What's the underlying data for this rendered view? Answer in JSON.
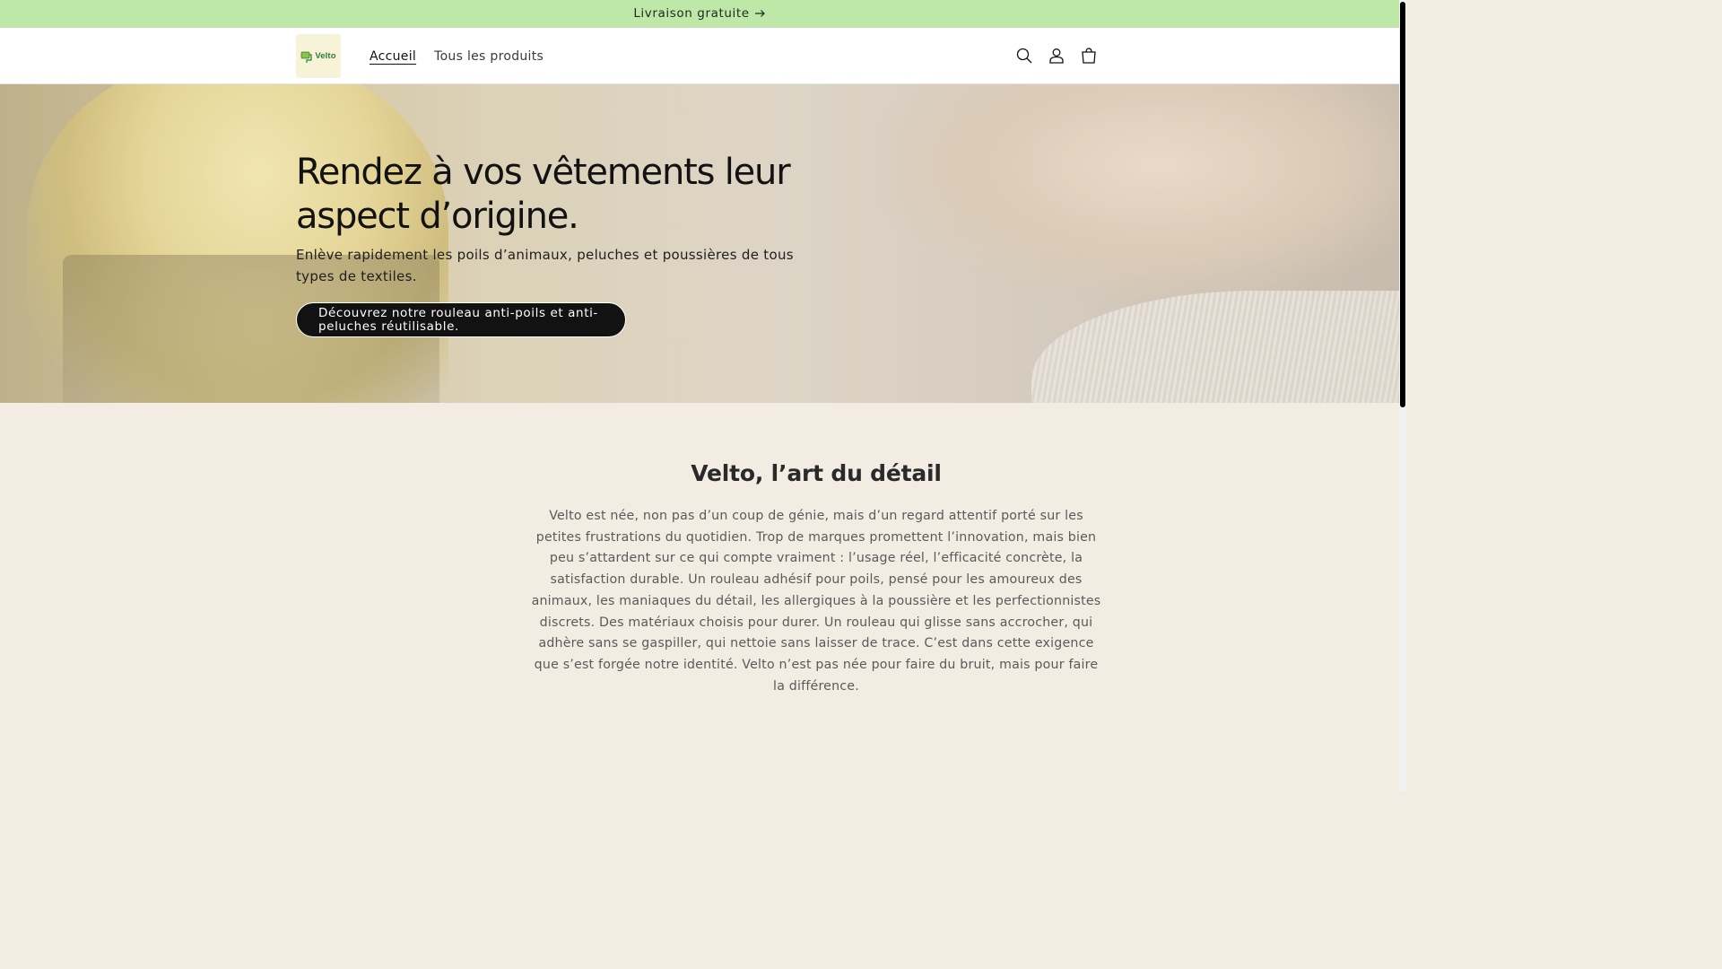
{
  "announcement": {
    "text": "Livraison gratuite",
    "icon": "arrow-right-icon"
  },
  "header": {
    "logo_text": "Velto",
    "nav": [
      {
        "label": "Accueil",
        "active": true
      },
      {
        "label": "Tous les produits",
        "active": false
      }
    ],
    "icons": [
      "search-icon",
      "account-icon",
      "cart-icon"
    ]
  },
  "hero": {
    "title": "Rendez à vos vêtements leur aspect d’origine.",
    "text": "Enlève rapidement les poils d’animaux, peluches et poussières de tous types de textiles.",
    "button_label": "Découvrez notre rouleau anti-poils et anti-peluches réutilisable."
  },
  "about": {
    "title": "Velto, l’art du détail",
    "text": "Velto est née, non pas d’un coup de génie, mais d’un regard attentif porté sur les petites frustrations du quotidien. Trop de marques promettent l’innovation, mais bien peu s’attardent sur ce qui compte vraiment : l’usage réel, l’efficacité concrète, la satisfaction durable. Un rouleau adhésif pour poils, pensé pour les amoureux des animaux, les maniaques du détail, les allergiques à la poussière et les perfectionnistes discrets. Des matériaux choisis pour durer. Un rouleau qui glisse sans accrocher, qui adhère sans se gaspiller, qui nettoie sans laisser de trace. C’est dans cette exigence que s’est forgée notre identité. Velto n’est pas née pour faire du bruit, mais pour faire la différence."
  },
  "colors": {
    "announcement_bg": "#bde8a8",
    "header_bg": "#ffffff",
    "page_bg": "#f3ece3",
    "button_bg": "#121212",
    "logo_green": "#2e7d32"
  }
}
